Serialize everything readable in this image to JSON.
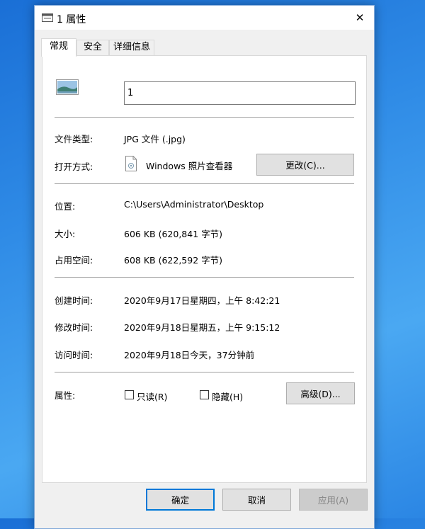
{
  "window": {
    "title": "1 属性",
    "close": "✕"
  },
  "tabs": [
    {
      "label": "常规",
      "active": true
    },
    {
      "label": "安全",
      "active": false
    },
    {
      "label": "详细信息",
      "active": false
    }
  ],
  "general": {
    "filename": "1",
    "type_label": "文件类型:",
    "type_value": "JPG 文件 (.jpg)",
    "open_with_label": "打开方式:",
    "open_with_app": "Windows 照片查看器",
    "change_button": "更改(C)...",
    "location_label": "位置:",
    "location_value": "C:\\Users\\Administrator\\Desktop",
    "size_label": "大小:",
    "size_value": "606 KB (620,841 字节)",
    "disk_label": "占用空间:",
    "disk_value": "608 KB (622,592 字节)",
    "created_label": "创建时间:",
    "created_value": "2020年9月17日星期四，上午 8:42:21",
    "modified_label": "修改时间:",
    "modified_value": "2020年9月18日星期五，上午 9:15:12",
    "accessed_label": "访问时间:",
    "accessed_value": "2020年9月18日今天，37分钟前",
    "attributes_label": "属性:",
    "readonly_label": "只读(R)",
    "hidden_label": "隐藏(H)",
    "advanced_button": "高级(D)..."
  },
  "footer": {
    "ok": "确定",
    "cancel": "取消",
    "apply": "应用(A)"
  },
  "colors": {
    "accent": "#0078d7",
    "separator": "#a0a0a0",
    "button": "#e1e1e1"
  }
}
